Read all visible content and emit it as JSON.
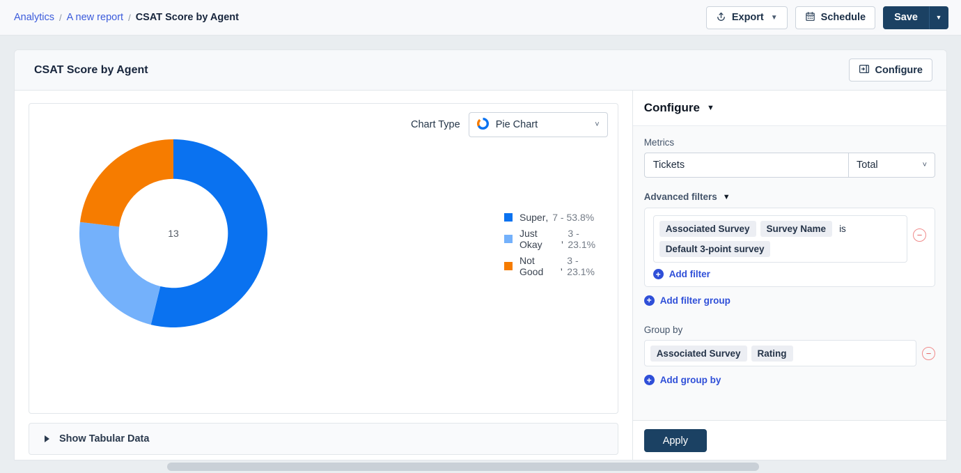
{
  "breadcrumb": {
    "items": [
      {
        "label": "Analytics",
        "current": false
      },
      {
        "label": "A new report",
        "current": false
      },
      {
        "label": "CSAT Score by Agent",
        "current": true
      }
    ],
    "separator": "/"
  },
  "topbar": {
    "export_label": "Export",
    "export_caret": "▼",
    "schedule_label": "Schedule",
    "save_label": "Save",
    "save_caret": "▼"
  },
  "card": {
    "title": "CSAT Score by Agent",
    "configure_button_label": "Configure"
  },
  "chart_type": {
    "label": "Chart Type",
    "value": "Pie Chart",
    "caret": "˅"
  },
  "tabular": {
    "label": "Show Tabular Data",
    "expanded": false
  },
  "configure": {
    "title": "Configure",
    "caret": "▼",
    "metrics_label": "Metrics",
    "metric_value": "Tickets",
    "aggregation_value": "Total",
    "aggregation_caret": "˅",
    "advanced_filters_label": "Advanced filters",
    "advanced_filters_caret": "▼",
    "filter": {
      "chips": [
        "Associated Survey",
        "Survey Name"
      ],
      "operator": "is",
      "value_chip": "Default 3-point survey",
      "remove_icon": "−"
    },
    "add_filter_label": "Add filter",
    "add_filter_group_label": "Add filter group",
    "group_by_label": "Group by",
    "group_by_chips": [
      "Associated Survey",
      "Rating"
    ],
    "group_by_remove_icon": "−",
    "add_group_by_label": "Add group by",
    "apply_label": "Apply",
    "plus_icon": "+"
  },
  "chart_data": {
    "type": "pie",
    "title": "CSAT Score by Agent",
    "variant": "donut",
    "center_label": "13",
    "total": 13,
    "legend_position": "right",
    "categories": [
      "Super",
      "Just Okay",
      "Not Good"
    ],
    "values": [
      7,
      3,
      3
    ],
    "percentages": [
      53.8,
      23.1,
      23.1
    ],
    "colors": [
      "#0a72f0",
      "#74b1fb",
      "#f67c00"
    ],
    "legend": [
      {
        "name": "Super",
        "value": "7 - 53.8%",
        "color": "#0a72f0"
      },
      {
        "name": "Just Okay",
        "value": "3 - 23.1%",
        "color": "#74b1fb"
      },
      {
        "name": "Not Good",
        "value": "3 - 23.1%",
        "color": "#f67c00"
      }
    ],
    "start_angle_deg": 0,
    "direction": "clockwise",
    "inner_radius_ratio": 0.58
  },
  "colors": {
    "accent_blue": "#0a72f0",
    "light_blue": "#74b1fb",
    "orange": "#f67c00",
    "link": "#2f4fd8",
    "navy": "#1b4163",
    "page_bg": "#e9edf0"
  }
}
